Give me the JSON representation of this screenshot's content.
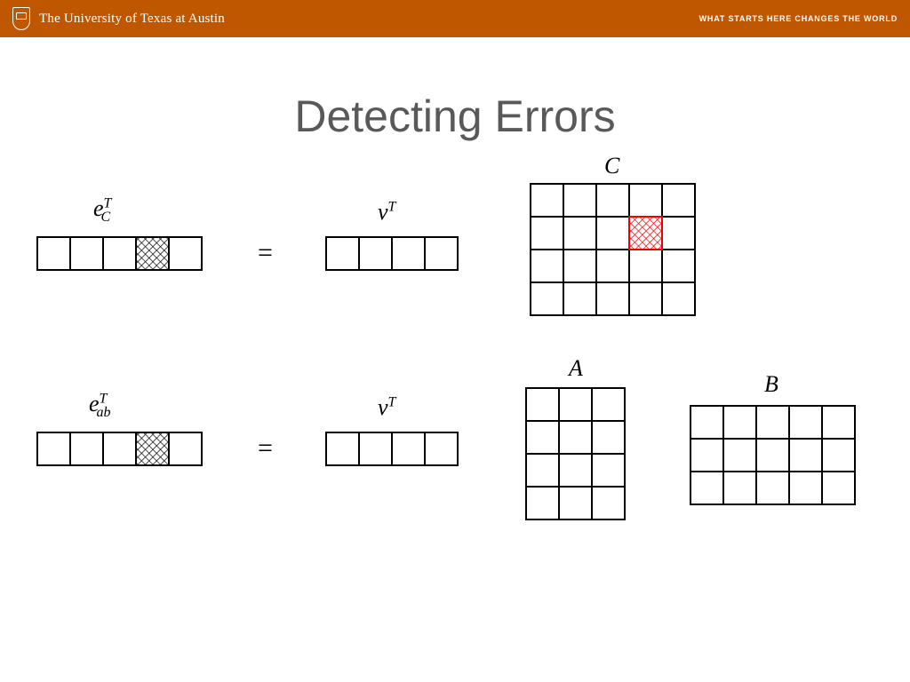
{
  "banner": {
    "university": "The University of Texas at Austin",
    "tagline": "WHAT STARTS HERE CHANGES THE WORLD"
  },
  "slide": {
    "title": "Detecting Errors"
  },
  "labels": {
    "eCT_base": "e",
    "eCT_sup": "T",
    "eCT_sub": "C",
    "eabT_base": "e",
    "eabT_sup": "T",
    "eabT_sub": "ab",
    "vT1_base": "v",
    "vT1_sup": "T",
    "vT2_base": "v",
    "vT2_sup": "T",
    "C": "C",
    "A": "A",
    "B": "B",
    "equals": "="
  },
  "chart_data": {
    "type": "diagram",
    "description": "Matrix error detection diagram: row vectors e^T_C and e^T_ab (1x5 with 4th cell shaded) equal v^T (1x4) times matrices. Top: C is 5x4 with cell row2,col4 marked red. Bottom: A is 3x4 and B is 5x3.",
    "elements": [
      {
        "name": "vector_eCT",
        "shape": [
          1,
          5
        ],
        "hatched_cells": [
          [
            0,
            3
          ]
        ],
        "hatch_color": "#000000"
      },
      {
        "name": "vector_vT_1",
        "shape": [
          1,
          4
        ]
      },
      {
        "name": "matrix_C",
        "shape": [
          4,
          5
        ],
        "hatched_cells": [
          [
            1,
            3
          ]
        ],
        "hatch_color": "#ff0000"
      },
      {
        "name": "vector_eabT",
        "shape": [
          1,
          5
        ],
        "hatched_cells": [
          [
            0,
            3
          ]
        ],
        "hatch_color": "#000000"
      },
      {
        "name": "vector_vT_2",
        "shape": [
          1,
          4
        ]
      },
      {
        "name": "matrix_A",
        "shape": [
          4,
          3
        ]
      },
      {
        "name": "matrix_B",
        "shape": [
          3,
          5
        ]
      }
    ],
    "equations": [
      "e_C^T = v^T · C",
      "e_ab^T = v^T · A · B"
    ]
  }
}
